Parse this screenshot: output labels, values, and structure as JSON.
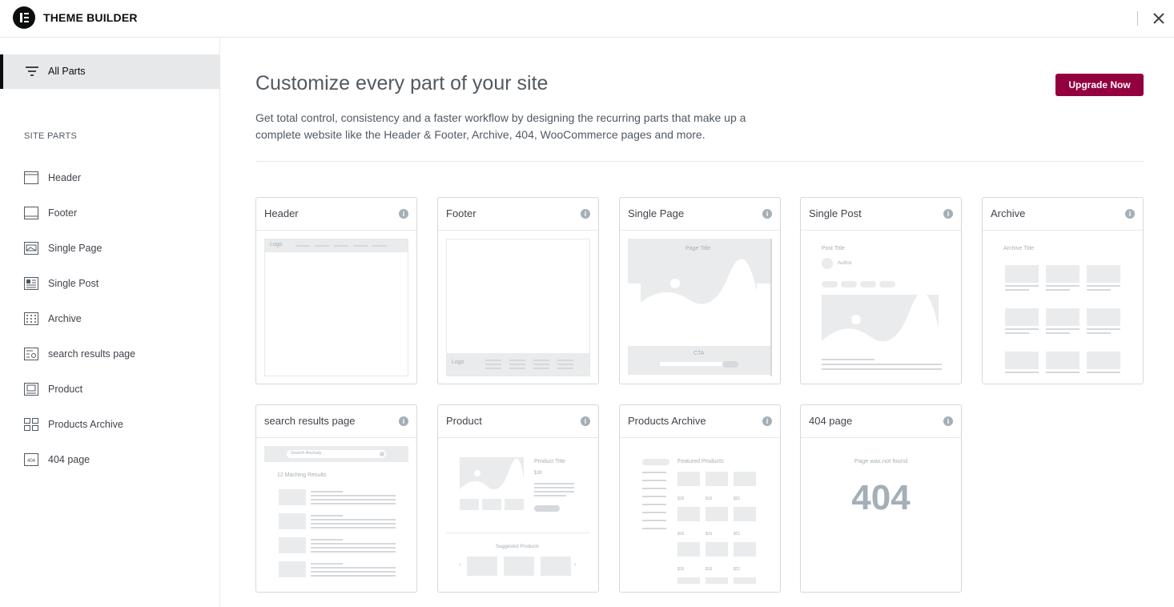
{
  "app": {
    "title": "THEME BUILDER"
  },
  "sidebar": {
    "all_parts_label": "All Parts",
    "section_title": "SITE PARTS",
    "items": [
      {
        "label": "Header",
        "icon": "header-icon"
      },
      {
        "label": "Footer",
        "icon": "footer-icon"
      },
      {
        "label": "Single Page",
        "icon": "single-page-icon"
      },
      {
        "label": "Single Post",
        "icon": "single-post-icon"
      },
      {
        "label": "Archive",
        "icon": "archive-icon"
      },
      {
        "label": "search results page",
        "icon": "search-results-icon"
      },
      {
        "label": "Product",
        "icon": "product-icon"
      },
      {
        "label": "Products Archive",
        "icon": "products-archive-icon"
      },
      {
        "label": "404 page",
        "icon": "404-page-icon"
      }
    ]
  },
  "main": {
    "heading": "Customize every part of your site",
    "description": "Get total control, consistency and a faster workflow by designing the recurring parts that make up a complete website like the Header & Footer, Archive, 404, WooCommerce pages and more.",
    "upgrade_label": "Upgrade Now",
    "cards": [
      {
        "title": "Header"
      },
      {
        "title": "Footer"
      },
      {
        "title": "Single Page"
      },
      {
        "title": "Single Post"
      },
      {
        "title": "Archive"
      },
      {
        "title": "search results page"
      },
      {
        "title": "Product"
      },
      {
        "title": "Products Archive"
      },
      {
        "title": "404 page"
      }
    ]
  },
  "previews": {
    "header_logo": "Logo",
    "footer_logo": "Logo",
    "single_page_title": "Page Title",
    "single_page_cta": "CTA",
    "post_title": "Post Title",
    "post_author": "Author",
    "archive_title": "Archive Title",
    "search_placeholder": "Search Anchaty",
    "search_results": "12 Maching Results",
    "product_title": "Product Title",
    "product_price": "$30",
    "suggested_products": "Suggested Products",
    "featured_products": "Featured Products",
    "prices": [
      "$16",
      "$15",
      "$21"
    ],
    "not_found": "Page was not found",
    "code_404": "404"
  },
  "colors": {
    "accent": "#93003f",
    "active_bg": "#e6e8ea"
  }
}
